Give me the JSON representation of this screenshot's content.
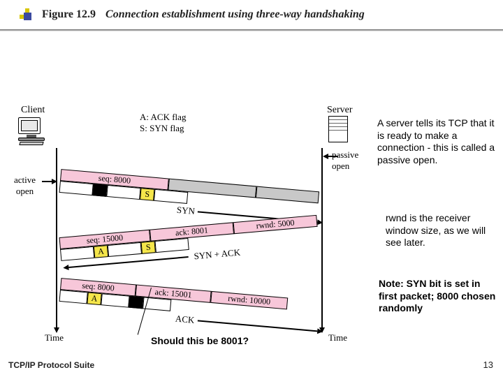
{
  "figure": {
    "label": "Figure 12.9",
    "title": "Connection establishment using three-way handshaking"
  },
  "endpoints": {
    "client": "Client",
    "server": "Server"
  },
  "legend_flags": {
    "a": "A: ACK flag",
    "s": "S: SYN flag"
  },
  "open": {
    "active": "active\nopen",
    "passive": "passive\nopen"
  },
  "time_label": "Time",
  "packets": {
    "syn": {
      "seq": "seq: 8000",
      "flagS": "S",
      "name": "SYN"
    },
    "synack": {
      "seq": "seq: 15000",
      "ack": "ack: 8001",
      "rwnd": "rwnd: 5000",
      "flagA": "A",
      "flagS": "S",
      "name": "SYN + ACK"
    },
    "ackpkt": {
      "seq": "seq: 8000",
      "ack": "ack: 15001",
      "rwnd": "rwnd: 10000",
      "flagA": "A",
      "name": "ACK"
    }
  },
  "annotations": {
    "server_note": "A server tells its TCP that it is ready to make a connection - this is called a passive open.",
    "rwnd_note": "rwnd is the receiver window size, as we will see later.",
    "syn_note": "Note: SYN bit is set in first packet; 8000 chosen randomly"
  },
  "question": "Should this be 8001?",
  "footer": {
    "left": "TCP/IP Protocol Suite",
    "page": "13"
  }
}
